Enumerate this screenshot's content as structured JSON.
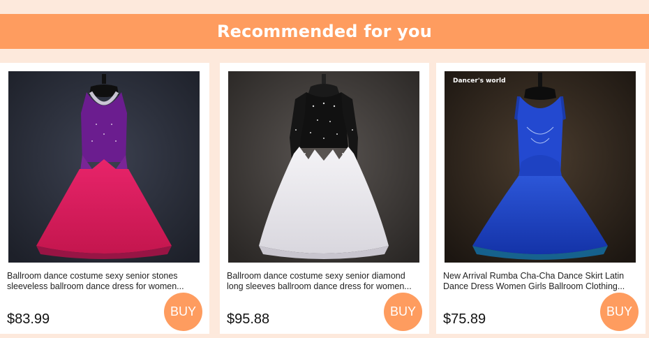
{
  "header": {
    "title": "Recommended for you"
  },
  "products": [
    {
      "title_line1": "Ballroom dance costume sexy senior diamond",
      "title_line2": "long sleeves ballroom dance dress for women...",
      "price": "$95.88",
      "buy_label": "BUY",
      "image": "black-and-white-ballroom-gown",
      "watermark": ""
    },
    {
      "title_line1": "New Arrival Rumba Cha-Cha Dance Skirt Latin",
      "title_line2": "Dance Dress Women Girls Ballroom Clothing...",
      "price": "$75.89",
      "buy_label": "BUY",
      "image": "royal-blue-ballroom-gown",
      "watermark": "Dancer's world"
    },
    {
      "title_line1": "Ballroom dance costume sexy senior stones",
      "title_line2": "sleeveless ballroom dance dress for women...",
      "price": "$83.99",
      "buy_label": "BUY",
      "image": "purple-and-red-ballroom-gown",
      "watermark": ""
    }
  ],
  "colors": {
    "page_background": "#fde9dc",
    "accent": "#fe9c5f",
    "card": "#ffffff"
  }
}
